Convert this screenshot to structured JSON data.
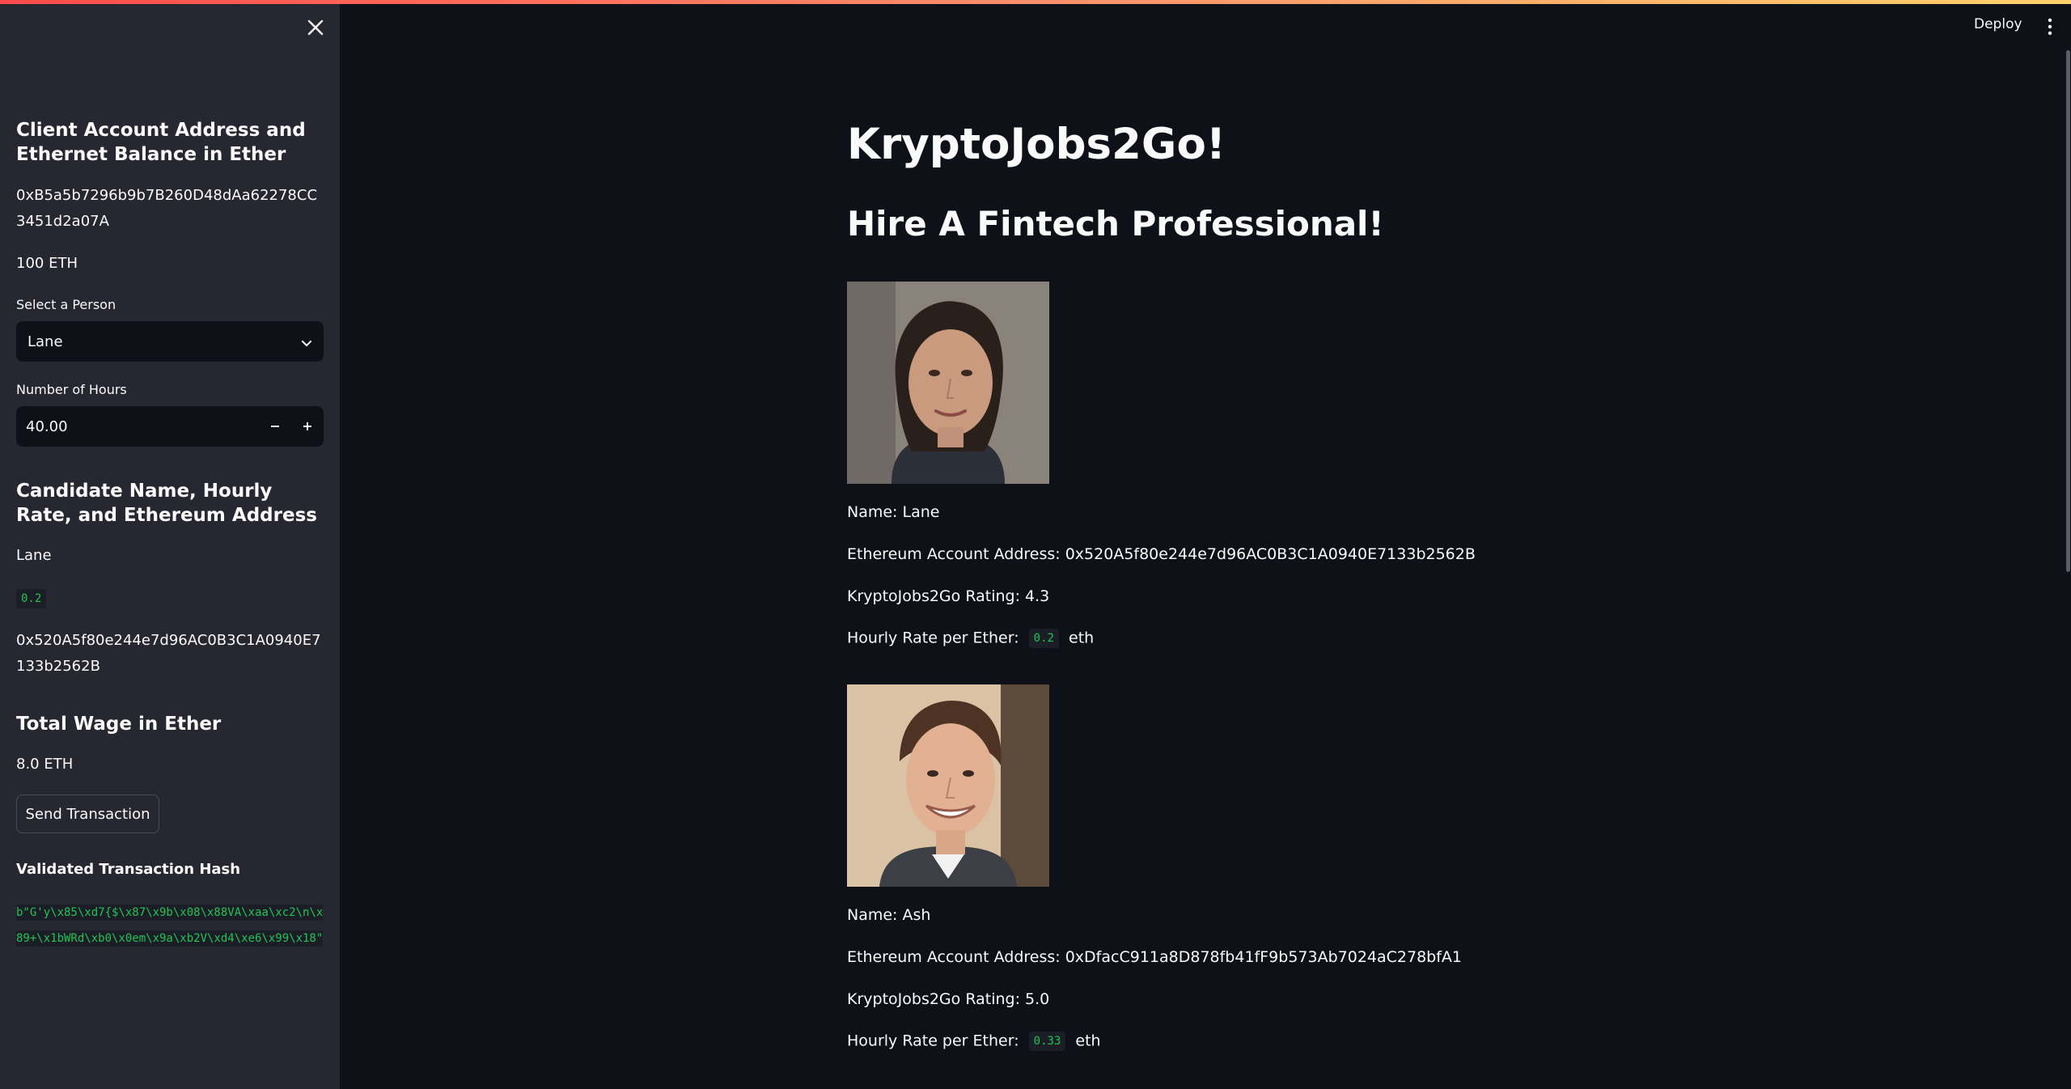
{
  "sidebar": {
    "client_heading": "Client Account Address and Ethernet Balance in Ether",
    "client_address": "0xB5a5b7296b9b7B260D48dAa62278CC3451d2a07A",
    "client_balance": "100 ETH",
    "select_label": "Select a Person",
    "selected_person": "Lane",
    "hours_label": "Number of Hours",
    "hours_value": "40.00",
    "candidate_heading": "Candidate Name, Hourly Rate, and Ethereum Address",
    "candidate_name": "Lane",
    "candidate_rate": "0.2",
    "candidate_address": "0x520A5f80e244e7d96AC0B3C1A0940E7133b2562B",
    "wage_heading": "Total Wage in Ether",
    "wage_value": "8.0 ETH",
    "send_button": "Send Transaction",
    "hash_heading": "Validated Transaction Hash",
    "hash_value": "b\"G'y\\x85\\xd7{$\\x87\\x9b\\x08\\x88VA\\xaa\\xc2\\n\\x89+\\x1bWRd\\xb0\\x0em\\x9a\\xb2V\\xd4\\xe6\\x99\\x18\""
  },
  "header": {
    "deploy_label": "Deploy"
  },
  "main": {
    "title": "KryptoJobs2Go!",
    "subtitle": "Hire A Fintech Professional!",
    "candidates": [
      {
        "name_line": "Name: Lane",
        "address_line": "Ethereum Account Address: 0x520A5f80e244e7d96AC0B3C1A0940E7133b2562B",
        "rating_line": "KryptoJobs2Go Rating: 4.3",
        "rate_prefix": "Hourly Rate per Ether:",
        "rate_value": "0.2",
        "rate_suffix": "eth"
      },
      {
        "name_line": "Name: Ash",
        "address_line": "Ethereum Account Address: 0xDfacC911a8D878fb41fF9b573Ab7024aC278bfA1",
        "rating_line": "KryptoJobs2Go Rating: 5.0",
        "rate_prefix": "Hourly Rate per Ether:",
        "rate_value": "0.33",
        "rate_suffix": "eth"
      }
    ]
  },
  "colors": {
    "background": "#0e1117",
    "sidebar": "#262730",
    "code_text": "#21c354"
  }
}
